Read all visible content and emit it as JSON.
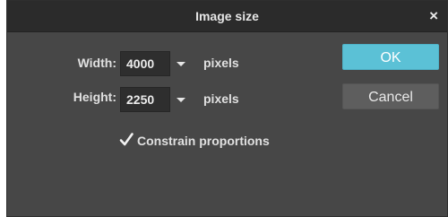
{
  "dialog": {
    "title": "Image size",
    "close_glyph": "×",
    "close_icon": "close-icon"
  },
  "width_field": {
    "label": "Width:",
    "value": "4000",
    "dropdown_icon": "chevron-down-icon",
    "unit": "pixels"
  },
  "height_field": {
    "label": "Height:",
    "value": "2250",
    "dropdown_icon": "chevron-down-icon",
    "unit": "pixels"
  },
  "buttons": {
    "ok_label": "OK",
    "cancel_label": "Cancel"
  },
  "constrain": {
    "checked": true,
    "check_icon": "checkmark-icon",
    "label": "Constrain proportions"
  },
  "colors": {
    "dialog_bg": "#474747",
    "titlebar_bg": "#2b2b2b",
    "accent": "#5bc1d6",
    "secondary_button": "#5e5e5e"
  }
}
